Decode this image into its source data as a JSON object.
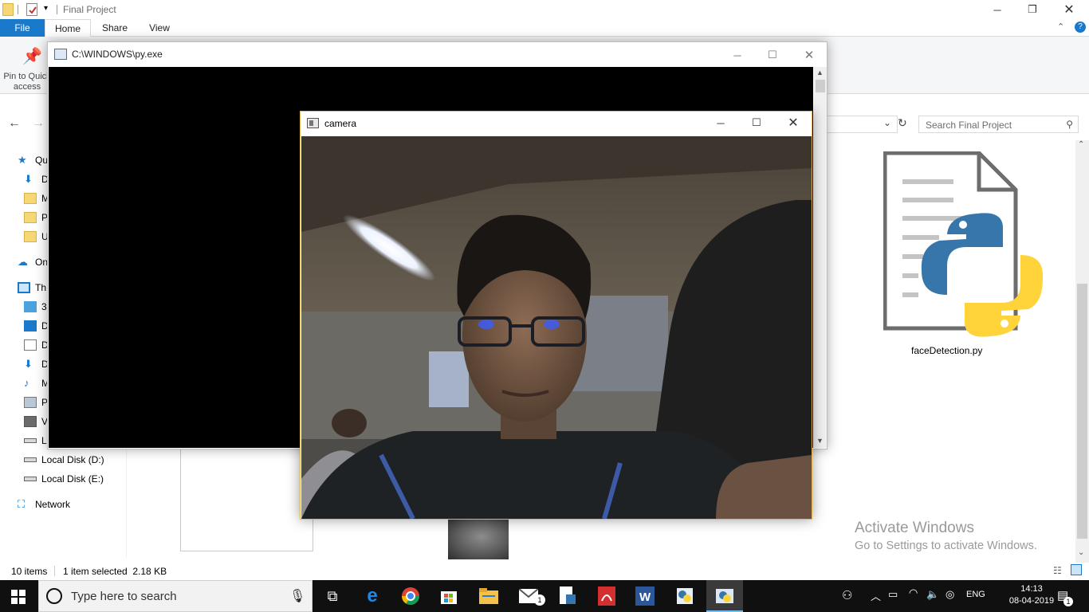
{
  "explorer": {
    "title": "Final Project",
    "tabs": {
      "file": "File",
      "home": "Home",
      "share": "Share",
      "view": "View"
    },
    "pin_label": "Pin to Quick access",
    "search_placeholder": "Search Final Project",
    "nav_items": [
      {
        "label": "Qu",
        "icon": "star-icon"
      },
      {
        "label": "D",
        "icon": "download-icon"
      },
      {
        "label": "M",
        "icon": "folder-icon"
      },
      {
        "label": "P",
        "icon": "folder-icon"
      },
      {
        "label": "U",
        "icon": "folder-icon"
      },
      {
        "label": "On",
        "icon": "onedrive-icon"
      },
      {
        "label": "Th",
        "icon": "pc-icon"
      },
      {
        "label": "3",
        "icon": "3d-objects-icon"
      },
      {
        "label": "D",
        "icon": "desktop-icon"
      },
      {
        "label": "D",
        "icon": "documents-icon"
      },
      {
        "label": "D",
        "icon": "download-icon"
      },
      {
        "label": "M",
        "icon": "music-icon"
      },
      {
        "label": "P",
        "icon": "pictures-icon"
      },
      {
        "label": "V",
        "icon": "videos-icon"
      },
      {
        "label": "L",
        "icon": "drive-icon"
      },
      {
        "label": "Local Disk (D:)",
        "icon": "drive-icon"
      },
      {
        "label": "Local Disk (E:)",
        "icon": "drive-icon"
      },
      {
        "label": "Network",
        "icon": "network-icon"
      }
    ],
    "file_name": "faceDetection.py",
    "status_items": "10 items",
    "status_selection": "1 item selected  2.18 KB",
    "activation_title": "Activate Windows",
    "activation_sub": "Go to Settings to activate Windows."
  },
  "console": {
    "title": "C:\\WINDOWS\\py.exe"
  },
  "camera": {
    "title": "camera"
  },
  "taskbar": {
    "search_text": "Type here to search",
    "language": "ENG",
    "time": "14:13",
    "date": "08-04-2019",
    "mail_badge": "1",
    "notification_badge": "1"
  },
  "colors": {
    "file_tab": "#1979ca",
    "camera_border": "#e3b449",
    "taskbar": "#101010"
  }
}
